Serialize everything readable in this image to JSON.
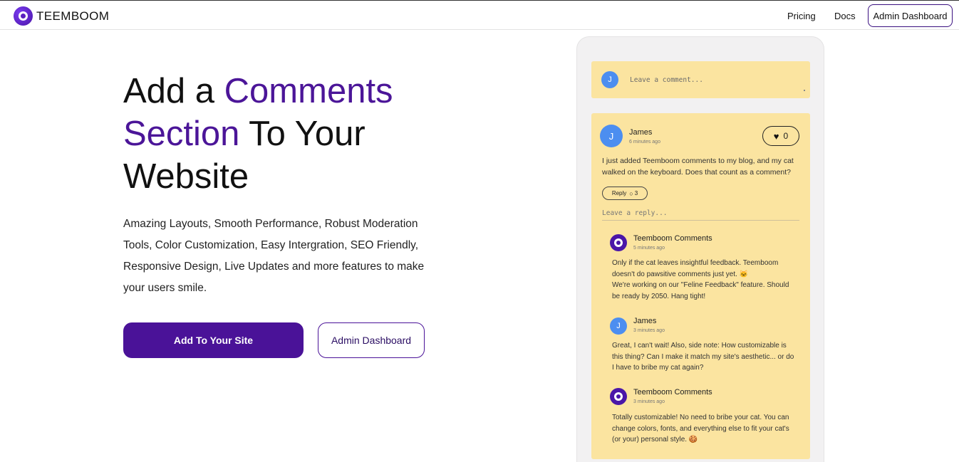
{
  "header": {
    "brand": "TEEMBOOM",
    "nav": {
      "pricing": "Pricing",
      "docs": "Docs",
      "admin": "Admin Dashboard"
    }
  },
  "hero": {
    "title_part1": "Add a ",
    "title_accent": "Comments Section",
    "title_part2": " To Your Website",
    "description": "Amazing Layouts, Smooth Performance, Robust Moderation Tools, Color Customization, Easy Intergration, SEO Friendly, Responsive Design, Live Updates and more features to make your users smile.",
    "primary_button": "Add To Your Site",
    "secondary_button": "Admin Dashboard"
  },
  "demo": {
    "compose": {
      "avatar_initial": "J",
      "placeholder": "Leave a comment..."
    },
    "comment": {
      "avatar_initial": "J",
      "author": "James",
      "time": "6 minutes ago",
      "body": "I just added Teemboom comments to my blog, and my cat walked on the keyboard. Does that count as a comment?",
      "likes": "0",
      "reply_label": "Reply",
      "reply_count": "3",
      "reply_placeholder": "Leave a reply..."
    },
    "replies": [
      {
        "author": "Teemboom Comments",
        "time": "5 minutes ago",
        "lines": [
          "Only if the cat leaves insightful feedback. Teemboom",
          "doesn't do pawsitive comments just yet. 🐱",
          "We're working on our \"Feline Feedback\" feature. Should",
          "be ready by 2050. Hang tight!"
        ]
      },
      {
        "avatar_initial": "J",
        "author": "James",
        "time": "3 minutes ago",
        "lines": [
          "Great, I can't wait! Also, side note: How customizable is",
          "this thing? Can I make it match my site's aesthetic... or do",
          "I have to bribe my cat again?"
        ]
      },
      {
        "author": "Teemboom Comments",
        "time": "3 minutes ago",
        "lines": [
          "Totally customizable! No need to bribe your cat. You can",
          "change colors, fonts, and everything else to fit your cat's",
          "(or your) personal style. 🍪"
        ]
      }
    ]
  },
  "colors": {
    "accent": "#4b1598",
    "primary_button": "#4a1298",
    "comment_bg": "#fbe4a0",
    "avatar_blue": "#4c8ef0"
  }
}
